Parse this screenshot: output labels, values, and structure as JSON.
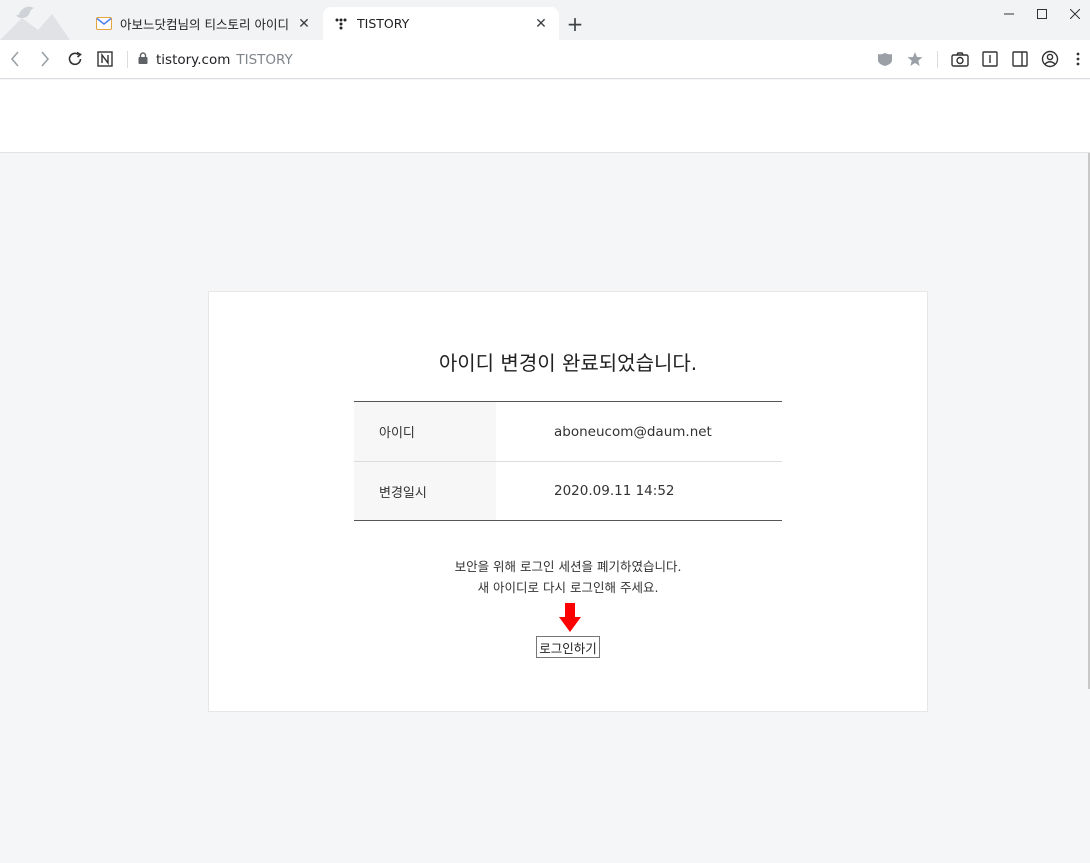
{
  "browser": {
    "tabs": [
      {
        "title": "아보느닷컴님의 티스토리 아이디",
        "close": "✕",
        "favicon": "mail-icon"
      },
      {
        "title": "TISTORY",
        "close": "✕",
        "favicon": "tistory-logo-icon"
      }
    ],
    "new_tab": "+",
    "address": {
      "url": "tistory.com",
      "page_title": "TISTORY"
    }
  },
  "card": {
    "heading": "아이디 변경이 완료되었습니다.",
    "rows": [
      {
        "label": "아이디",
        "value": "aboneucom@daum.net"
      },
      {
        "label": "변경일시",
        "value": "2020.09.11 14:52"
      }
    ],
    "notice_line1": "보안을 위해 로그인 세션을 폐기하였습니다.",
    "notice_line2": "새 아이디로 다시 로그인해 주세요.",
    "login_button": "로그인하기"
  },
  "colors": {
    "arrow": "#ff0000",
    "page_bg": "#f5f6f8"
  }
}
